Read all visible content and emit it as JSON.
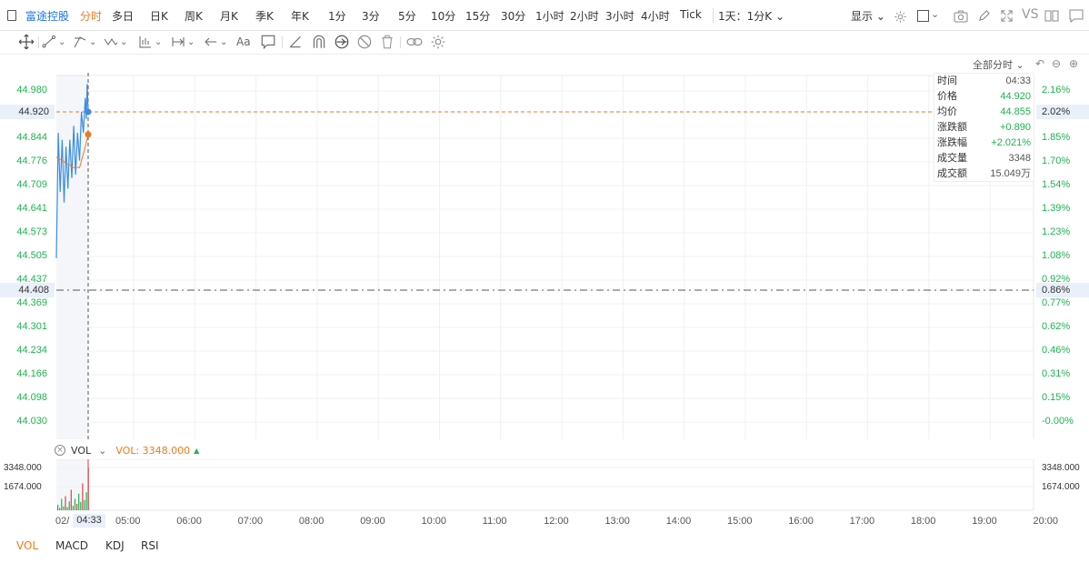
{
  "toolbar": {
    "ticker": "富途控股",
    "timeframes": [
      "分时",
      "多日",
      "日K",
      "周K",
      "月K",
      "季K",
      "年K",
      "1分",
      "3分",
      "5分",
      "10分",
      "15分",
      "30分",
      "1小时",
      "2小时",
      "3小时",
      "4小时",
      "Tick"
    ],
    "active_timeframe": "分时",
    "period_select": "1天：1分K",
    "display_label": "显示",
    "vs_label": "VS"
  },
  "drawing_tools": {
    "text_tool": "Aa"
  },
  "chart": {
    "full_period_label": "全部分时",
    "left_axis": [
      "44.980",
      "44.920",
      "44.844",
      "44.776",
      "44.709",
      "44.641",
      "44.573",
      "44.505",
      "44.437",
      "44.408",
      "44.369",
      "44.301",
      "44.234",
      "44.166",
      "44.098",
      "44.030"
    ],
    "right_axis": [
      "2.16%",
      "2.02%",
      "1.85%",
      "1.70%",
      "1.54%",
      "1.39%",
      "1.23%",
      "1.08%",
      "0.92%",
      "0.86%",
      "0.77%",
      "0.62%",
      "0.46%",
      "0.31%",
      "0.15%",
      "-0.00%"
    ],
    "current_price": "44.920",
    "current_pct": "2.02%",
    "prev_close": "44.408",
    "prev_close_pct": "0.86%"
  },
  "info_panel": {
    "rows": [
      {
        "label": "时间",
        "value": "04:33"
      },
      {
        "label": "价格",
        "value": "44.920"
      },
      {
        "label": "均价",
        "value": "44.855"
      },
      {
        "label": "涨跌额",
        "value": "+0.890"
      },
      {
        "label": "涨跌幅",
        "value": "+2.021%"
      },
      {
        "label": "成交量",
        "value": "3348"
      },
      {
        "label": "成交额",
        "value": "15.049万"
      }
    ]
  },
  "volume": {
    "name": "VOL",
    "value_text": "VOL: 3348.000",
    "axis": [
      "3348.000",
      "1674.000"
    ]
  },
  "time_axis": {
    "start": "02/",
    "cursor": "04:33",
    "labels": [
      "05:00",
      "06:00",
      "07:00",
      "08:00",
      "09:00",
      "10:00",
      "11:00",
      "12:00",
      "13:00",
      "14:00",
      "15:00",
      "16:00",
      "17:00",
      "18:00",
      "19:00",
      "20:00"
    ]
  },
  "indicators": [
    "VOL",
    "MACD",
    "KDJ",
    "RSI"
  ],
  "active_indicator": "VOL",
  "colors": {
    "accent": "#f07a1b",
    "up": "#1db34e",
    "price_line": "#3b8de0",
    "avg_line": "#f07a1b",
    "link": "#1a73e8"
  },
  "chart_data": {
    "type": "line",
    "series": [
      {
        "name": "价格",
        "x": [
          "04:00",
          "04:02",
          "04:04",
          "04:06",
          "04:08",
          "04:10",
          "04:12",
          "04:14",
          "04:16",
          "04:18",
          "04:20",
          "04:22",
          "04:24",
          "04:26",
          "04:28",
          "04:30",
          "04:31",
          "04:32",
          "04:33"
        ],
        "values": [
          44.5,
          44.86,
          44.69,
          44.84,
          44.66,
          44.82,
          44.7,
          44.84,
          44.73,
          44.88,
          44.74,
          44.86,
          44.78,
          44.92,
          44.86,
          44.96,
          44.9,
          45.0,
          44.92
        ]
      },
      {
        "name": "均价",
        "x": [
          "04:00",
          "04:06",
          "04:12",
          "04:18",
          "04:24",
          "04:30",
          "04:33"
        ],
        "values": [
          44.79,
          44.78,
          44.77,
          44.76,
          44.76,
          44.82,
          44.855
        ]
      }
    ],
    "volume": [
      420,
      180,
      900,
      300,
      1100,
      250,
      700,
      1600,
      350,
      900,
      500,
      1300,
      650,
      2100,
      800,
      1400,
      3348
    ],
    "ylim": [
      44.03,
      44.99
    ],
    "reference_line": 44.408
  }
}
